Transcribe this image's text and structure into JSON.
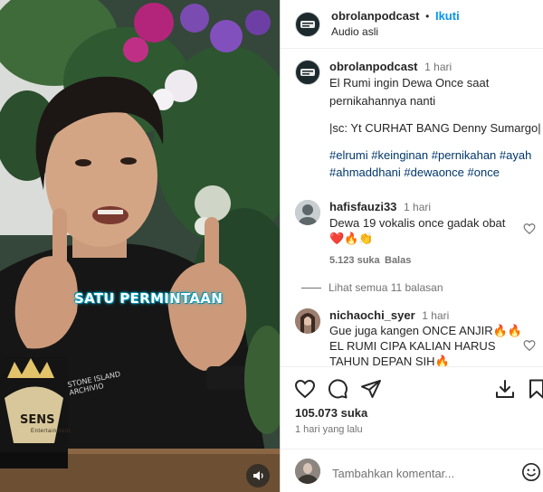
{
  "video": {
    "overlay_caption": "SATU PERMINTAAN",
    "sponsor_logo": "SENS",
    "sponsor_logo_sub": "Entertainment",
    "shirt_print": "STONE ISLAND",
    "shirt_print_sub": "ARCHIVIO",
    "mute_icon": "speaker-icon"
  },
  "header": {
    "username": "obrolanpodcast",
    "separator": "•",
    "follow_label": "Ikuti",
    "audio": "Audio asli"
  },
  "post_caption": {
    "username": "obrolanpodcast",
    "age": "1 hari",
    "line1": "El Rumi ingin Dewa Once saat",
    "line2": "pernikahannya nanti",
    "line3": "|sc: Yt CURHAT BANG Denny Sumargo|",
    "tags_line1": "#elrumi #keinginan #pernikahan #ayah",
    "tags_line2": "#ahmaddhani #dewaonce #once"
  },
  "comments": [
    {
      "username": "hafisfauzi33",
      "age": "1 hari",
      "text_line1": "Dewa 19 vokalis once gadak obat",
      "text_line2": "❤️🔥👏",
      "likes": "5.123 suka",
      "reply_label": "Balas",
      "view_replies": "Lihat semua 11 balasan"
    },
    {
      "username": "nichaochi_syer",
      "age": "1 hari",
      "text_line1": "Gue juga kangen ONCE ANJIR🔥🔥",
      "text_line2": "EL RUMI CIPA KALIAN HARUS",
      "text_line3": "TAHUN DEPAN SIH🔥"
    }
  ],
  "actions": {
    "icons": [
      "heart-icon",
      "comment-icon",
      "share-icon",
      "download-icon",
      "bookmark-icon"
    ]
  },
  "likes_count": "105.073 suka",
  "posted": "1 hari yang lalu",
  "comment_box": {
    "placeholder": "Tambahkan komentar...",
    "emoji_icon": "emoji-icon"
  },
  "colors": {
    "link_blue": "#0095f6",
    "hashtag": "#00376b",
    "muted": "#737373",
    "text": "#262626"
  }
}
